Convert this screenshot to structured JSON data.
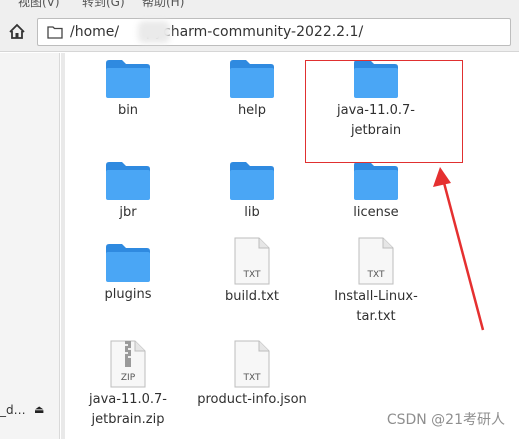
{
  "menu": {
    "items": [
      "视图(V)",
      "转到(G)",
      "帮助(H)"
    ]
  },
  "toolbar": {
    "address_path": "/home/      pycharm-community-2022.2.1/"
  },
  "sidebar": {
    "truncated_item": "_d…"
  },
  "files": [
    {
      "name": "bin",
      "type": "folder"
    },
    {
      "name": "help",
      "type": "folder"
    },
    {
      "name": "java-11.0.7-jetbrain",
      "type": "folder"
    },
    {
      "name": "jbr",
      "type": "folder"
    },
    {
      "name": "lib",
      "type": "folder"
    },
    {
      "name": "license",
      "type": "folder"
    },
    {
      "name": "plugins",
      "type": "folder"
    },
    {
      "name": "build.txt",
      "type": "text",
      "badge": "TXT"
    },
    {
      "name": "Install-Linux-tar.txt",
      "type": "text",
      "badge": "TXT"
    },
    {
      "name": "java-11.0.7-jetbrain.zip",
      "type": "zip",
      "badge": "ZIP"
    },
    {
      "name": "product-info.json",
      "type": "text",
      "badge": "TXT"
    }
  ],
  "labels": {
    "bin": "bin",
    "help": "help",
    "java_line1": "java-11.0.7-",
    "java_line2": "jetbrain",
    "jbr": "jbr",
    "lib": "lib",
    "license": "license",
    "plugins": "plugins",
    "build": "build.txt",
    "install_line1": "Install-Linux-",
    "install_line2": "tar.txt",
    "zip_line1": "java-11.0.7-",
    "zip_line2": "jetbrain.zip",
    "product": "product-info.json"
  },
  "badges": {
    "txt": "TXT",
    "zip": "ZIP"
  },
  "watermark": "CSDN @21考研人",
  "colors": {
    "folder": "#3d9ff2",
    "folder_light": "#64b6fb",
    "highlight": "#e03030"
  }
}
